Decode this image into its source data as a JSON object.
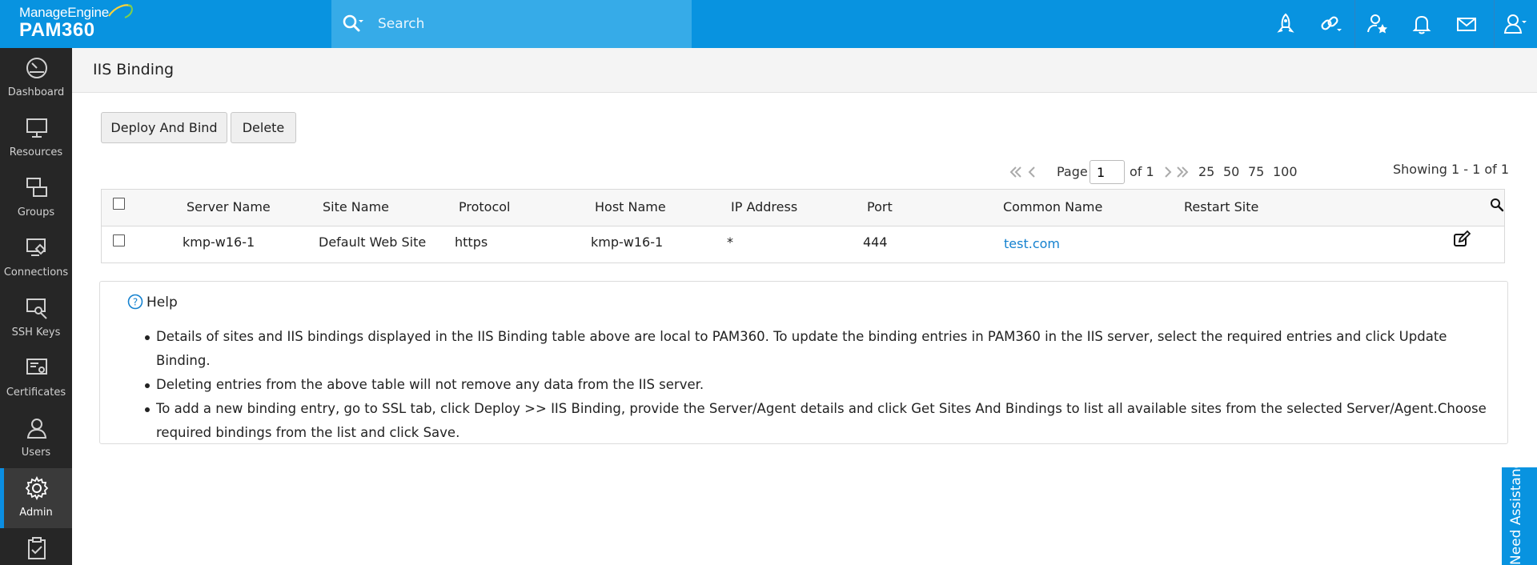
{
  "header": {
    "brand": "ManageEngine",
    "product": "PAM360",
    "search_placeholder": "Search",
    "icons": [
      "rocket-icon",
      "link-icon",
      "user-star-icon",
      "bell-icon",
      "mail-icon",
      "user-icon"
    ]
  },
  "sidebar": {
    "items": [
      {
        "label": "Dashboard",
        "icon": "gauge-icon"
      },
      {
        "label": "Resources",
        "icon": "monitor-icon"
      },
      {
        "label": "Groups",
        "icon": "groups-icon"
      },
      {
        "label": "Connections",
        "icon": "connections-icon"
      },
      {
        "label": "SSH Keys",
        "icon": "ssh-key-icon"
      },
      {
        "label": "Certificates",
        "icon": "certificate-icon"
      },
      {
        "label": "Users",
        "icon": "users-icon"
      },
      {
        "label": "Admin",
        "icon": "gear-icon",
        "active": true
      },
      {
        "label": "",
        "icon": "clipboard-check-icon"
      }
    ]
  },
  "page": {
    "title": "IIS Binding",
    "buttons": {
      "deploy": "Deploy And Bind",
      "delete": "Delete"
    }
  },
  "pager": {
    "page_label": "Page",
    "page_value": "1",
    "of_label": "of 1",
    "sizes": [
      "25",
      "50",
      "75",
      "100"
    ],
    "showing": "Showing 1 - 1 of 1"
  },
  "table": {
    "columns": [
      "Server Name",
      "Site Name",
      "Protocol",
      "Host Name",
      "IP Address",
      "Port",
      "Common Name",
      "Restart Site"
    ],
    "rows": [
      {
        "server": "kmp-w16-1",
        "site": "Default Web Site",
        "protocol": "https",
        "host": "kmp-w16-1",
        "ip": "*",
        "port": "444",
        "common": "test.com",
        "restart": ""
      }
    ]
  },
  "help": {
    "title": "Help",
    "items": [
      "Details of sites and IIS bindings displayed in the IIS Binding table above are local to PAM360. To update the binding entries in PAM360 in the IIS server, select the required entries and click Update Binding.",
      "Deleting entries from the above table will not remove any data from the IIS server.",
      "To add a new binding entry, go to SSL tab, click Deploy >> IIS Binding, provide the Server/Agent details and click Get Sites And Bindings to list all available sites from the selected Server/Agent.Choose required bindings from the list and click Save."
    ]
  },
  "assist": {
    "label": "Need Assistance?"
  },
  "colors": {
    "topbar": "#0893e0",
    "search": "#36abe8",
    "sidebar": "#262626",
    "accent": "#0b8ee2",
    "link": "#1481cf"
  }
}
